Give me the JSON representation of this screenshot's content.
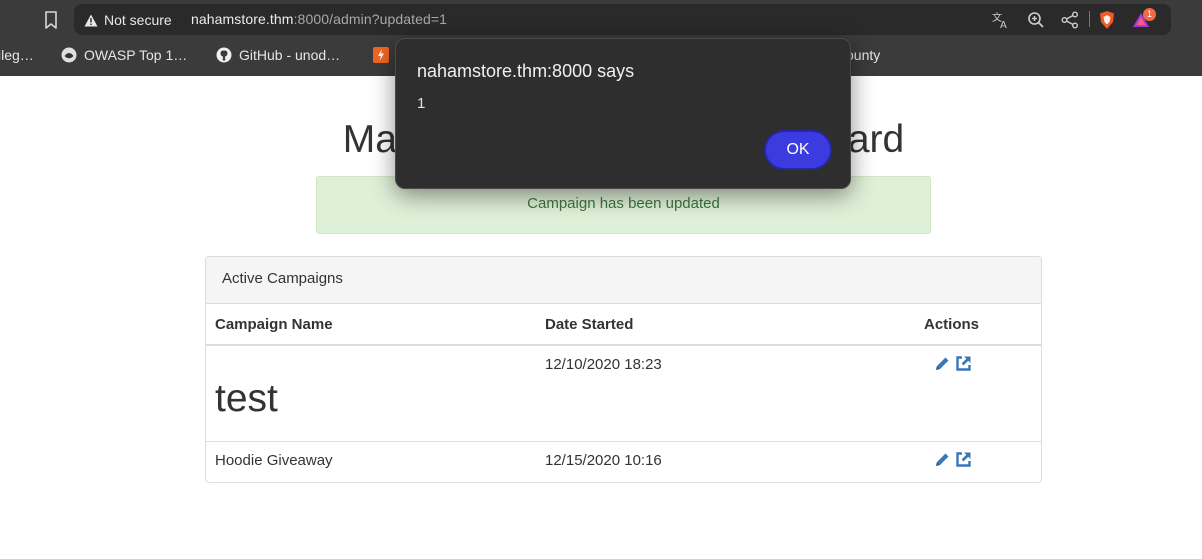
{
  "browser": {
    "security_label": "Not secure",
    "url_host": "nahamstore.thm",
    "url_rest": ":8000/admin?updated=1",
    "notification_count": "1",
    "bookmarks": [
      {
        "label": "ileg…"
      },
      {
        "label": "OWASP Top 1…"
      },
      {
        "label": "GitHub - unod…"
      },
      {
        "label": "ounty"
      }
    ]
  },
  "page": {
    "title": "Marketing Campaign Dashboard",
    "alert": "Campaign has been updated"
  },
  "panel": {
    "heading": "Active Campaigns",
    "columns": [
      "Campaign Name",
      "Date Started",
      "Actions"
    ],
    "rows": [
      {
        "name": "test",
        "date": "12/10/2020 18:23"
      },
      {
        "name": "Hoodie Giveaway",
        "date": "12/15/2020 10:16"
      }
    ]
  },
  "dialog": {
    "title": "nahamstore.thm:8000 says",
    "message": "1",
    "ok_label": "OK"
  },
  "colors": {
    "chrome": "#3b3b3b",
    "alert_bg": "#dff0d8",
    "alert_text": "#3c763d",
    "action_icon": "#3a76b8",
    "ok_button": "#3b3bdf"
  }
}
